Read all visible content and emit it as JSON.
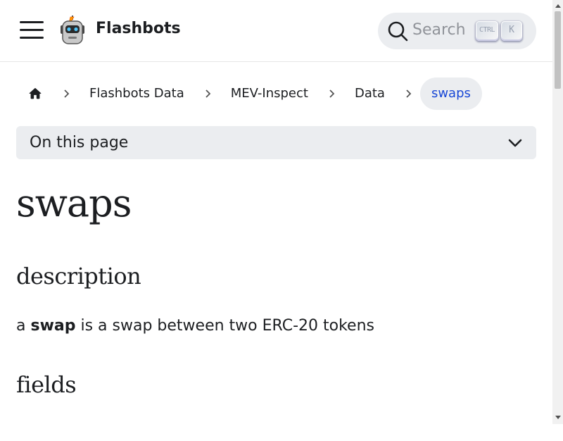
{
  "navbar": {
    "brand": "Flashbots",
    "search": {
      "placeholder": "Search",
      "kbd_ctrl": "CTRL",
      "kbd_k": "K"
    }
  },
  "breadcrumbs": {
    "items": [
      "Flashbots Data",
      "MEV-Inspect",
      "Data"
    ],
    "active": "swaps"
  },
  "toc": {
    "label": "On this page"
  },
  "content": {
    "title": "swaps",
    "section1": "description",
    "para_pre": "a ",
    "para_bold": "swap",
    "para_post": " is a swap between two ERC-20 tokens",
    "section2": "fields"
  },
  "colors": {
    "link_active": "#1847d6",
    "chip_bg": "#ebedf0",
    "text": "#1c1e21"
  },
  "icons": [
    "menu-icon",
    "robot-logo",
    "search-icon",
    "home-icon",
    "chevron-right-icon",
    "chevron-down-icon"
  ]
}
